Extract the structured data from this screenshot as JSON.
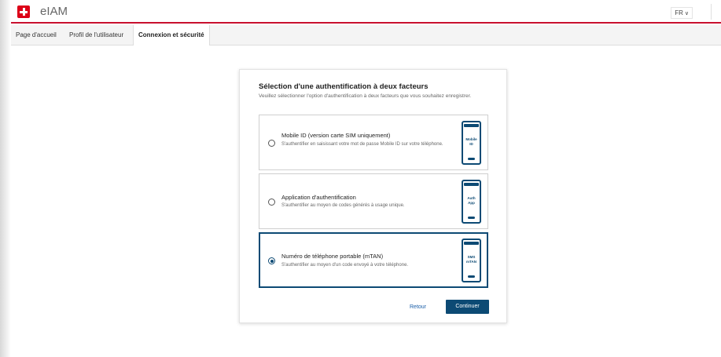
{
  "header": {
    "app_title": "eIAM",
    "language": "FR"
  },
  "nav": {
    "tabs": [
      {
        "label": "Page d'accueil"
      },
      {
        "label": "Profil de l'utilisateur"
      },
      {
        "label": "Connexion et sécurité",
        "active": true
      }
    ]
  },
  "card": {
    "title": "Sélection d'une authentification à deux facteurs",
    "description": "Veuillez sélectionner l'option d'authentification à deux facteurs que vous souhaitez enregistrer.",
    "options": [
      {
        "title": "Mobile ID (version carte SIM uniquement)",
        "description": "S'authentifier en saisissant votre mot de passe Mobile ID sur votre téléphone.",
        "icon_label_1": "Mobile",
        "icon_label_2": "ID",
        "selected": false
      },
      {
        "title": "Application d'authentification",
        "description": "S'authentifier au moyen de codes générés à usage unique.",
        "icon_label_1": "Auth",
        "icon_label_2": "App",
        "selected": false
      },
      {
        "title": "Numéro de téléphone portable (mTAN)",
        "description": "S'authentifier au moyen d'un code envoyé à votre téléphone.",
        "icon_label_1": "SMS",
        "icon_label_2": "mTAN",
        "selected": true
      }
    ],
    "back_label": "Retour",
    "continue_label": "Continuer"
  },
  "colors": {
    "brand_red": "#dc0018",
    "primary_blue": "#0c4a74"
  }
}
